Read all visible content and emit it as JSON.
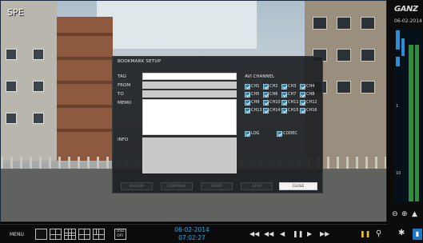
{
  "camera": {
    "label": "SPE"
  },
  "dialog": {
    "title": "BOOKMARK SETUP",
    "fields": {
      "tag": "TAG",
      "from": "FROM",
      "to": "TO",
      "memo": "MEMO",
      "info": "INFO"
    },
    "channel_header": "AVI CHANNEL",
    "channels": [
      "CH1",
      "CH2",
      "CH3",
      "CH4",
      "CH5",
      "CH6",
      "CH7",
      "CH8",
      "CH9",
      "CH10",
      "CH11",
      "CH12",
      "CH13",
      "CH14",
      "CH15",
      "CH16"
    ],
    "options": [
      "LOG",
      "CODEC"
    ],
    "buttons": {
      "backup": "BACKUP",
      "continue": "CONTINUE",
      "start": "START",
      "stop": "STOP",
      "close": "CLOSE"
    }
  },
  "right_panel": {
    "logo": "GANZ",
    "date": "06-02-2014",
    "ticks": [
      "",
      "1",
      "10"
    ]
  },
  "bottom": {
    "menu": "MENU",
    "osd": "OSD\nOFF",
    "date": "06-02-2014",
    "time": "07:02:27"
  },
  "colors": {
    "accent": "#2ba4e8",
    "record_blue": "#2a8fd8",
    "record_green": "#2e8f3a",
    "pause": "#f0c020"
  }
}
